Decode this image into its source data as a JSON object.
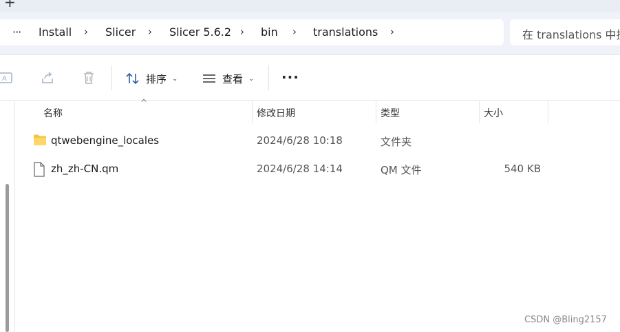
{
  "address": {
    "overflow_label": "···",
    "crumbs": [
      "Install",
      "Slicer",
      "Slicer 5.6.2",
      "bin",
      "translations"
    ],
    "separator": "›",
    "search_placeholder": "在 translations 中搜"
  },
  "toolbar": {
    "sort_label": "排序",
    "view_label": "查看",
    "more_label": "···"
  },
  "columns": {
    "name": "名称",
    "modified": "修改日期",
    "type": "类型",
    "size": "大小"
  },
  "files": [
    {
      "icon": "folder-icon",
      "name": "qtwebengine_locales",
      "modified": "2024/6/28 10:18",
      "type": "文件夹",
      "size": ""
    },
    {
      "icon": "file-icon",
      "name": "zh_zh-CN.qm",
      "modified": "2024/6/28 14:14",
      "type": "QM 文件",
      "size": "540 KB"
    }
  ],
  "watermark": "CSDN @Bling2157",
  "colors": {
    "folder": "#f5c443",
    "chrome": "#eff3f9"
  }
}
